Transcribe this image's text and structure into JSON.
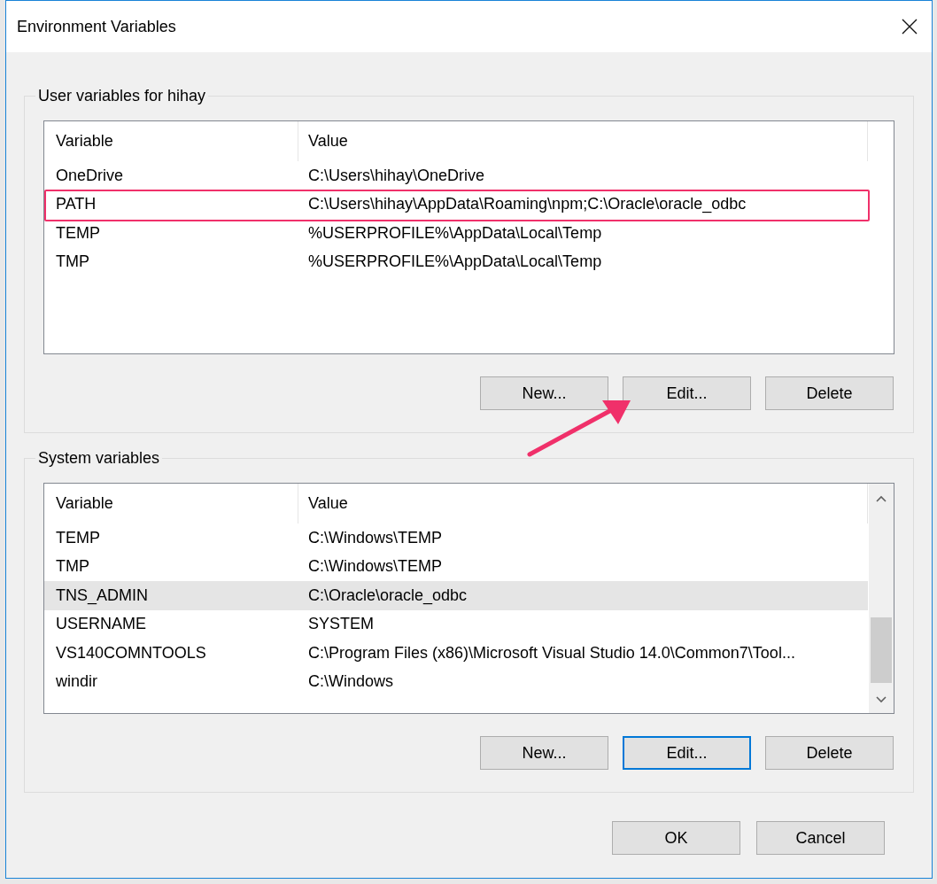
{
  "window": {
    "title": "Environment Variables"
  },
  "user_variables": {
    "title": "User variables for hihay",
    "columns": [
      "Variable",
      "Value"
    ],
    "rows": [
      {
        "variable": "OneDrive",
        "value": "C:\\Users\\hihay\\OneDrive",
        "selected": false,
        "annotated": false
      },
      {
        "variable": "PATH",
        "value": "C:\\Users\\hihay\\AppData\\Roaming\\npm;C:\\Oracle\\oracle_odbc",
        "selected": false,
        "annotated": true
      },
      {
        "variable": "TEMP",
        "value": "%USERPROFILE%\\AppData\\Local\\Temp",
        "selected": false,
        "annotated": false
      },
      {
        "variable": "TMP",
        "value": "%USERPROFILE%\\AppData\\Local\\Temp",
        "selected": false,
        "annotated": false
      }
    ],
    "buttons": [
      {
        "label": "New...",
        "focused": false
      },
      {
        "label": "Edit...",
        "focused": false
      },
      {
        "label": "Delete",
        "focused": false
      }
    ]
  },
  "system_variables": {
    "title": "System variables",
    "columns": [
      "Variable",
      "Value"
    ],
    "rows": [
      {
        "variable": "TEMP",
        "value": "C:\\Windows\\TEMP",
        "selected": false,
        "annotated": false
      },
      {
        "variable": "TMP",
        "value": "C:\\Windows\\TEMP",
        "selected": false,
        "annotated": false
      },
      {
        "variable": "TNS_ADMIN",
        "value": "C:\\Oracle\\oracle_odbc",
        "selected": true,
        "annotated": false
      },
      {
        "variable": "USERNAME",
        "value": "SYSTEM",
        "selected": false,
        "annotated": false
      },
      {
        "variable": "VS140COMNTOOLS",
        "value": "C:\\Program Files (x86)\\Microsoft Visual Studio 14.0\\Common7\\Tool...",
        "selected": false,
        "annotated": false
      },
      {
        "variable": "windir",
        "value": "C:\\Windows",
        "selected": false,
        "annotated": false
      }
    ],
    "buttons": [
      {
        "label": "New...",
        "focused": false
      },
      {
        "label": "Edit...",
        "focused": true
      },
      {
        "label": "Delete",
        "focused": false
      }
    ]
  },
  "footer_buttons": [
    {
      "label": "OK",
      "focused": false
    },
    {
      "label": "Cancel",
      "focused": false
    }
  ]
}
